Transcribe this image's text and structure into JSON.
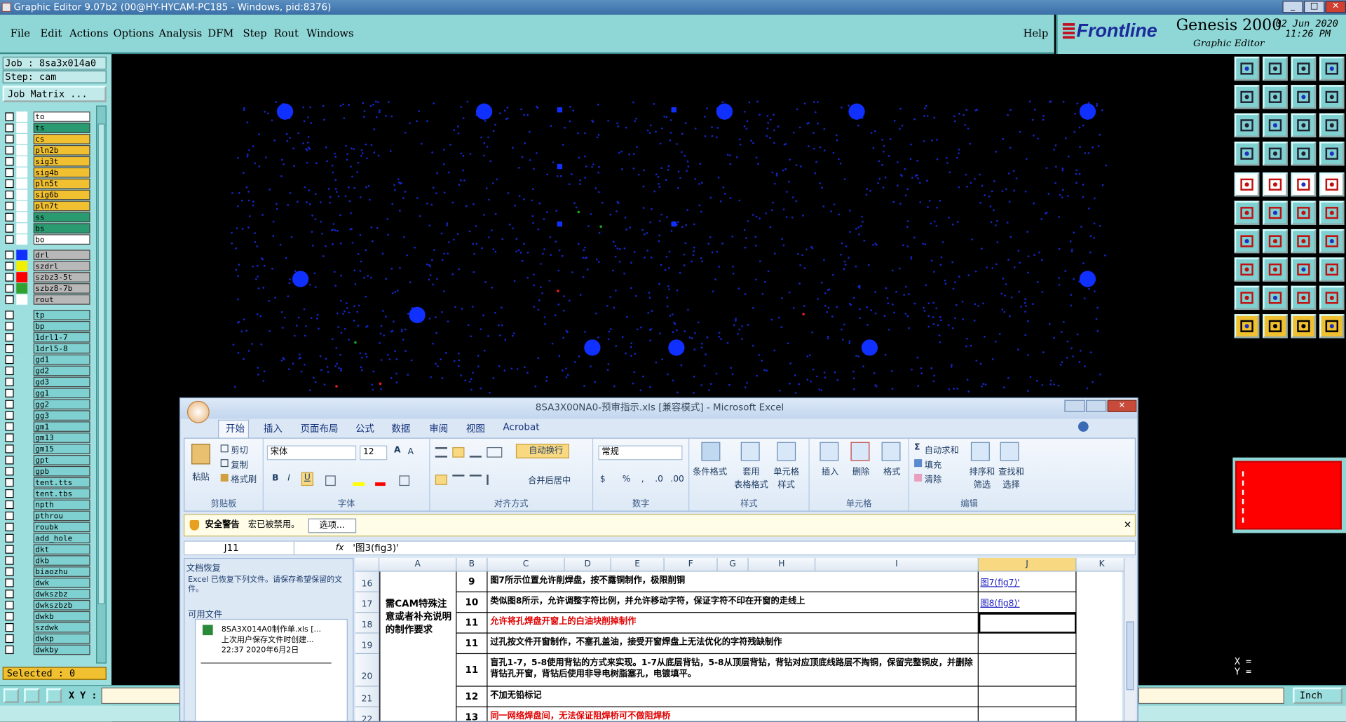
{
  "window": {
    "title": "Graphic Editor 9.07b2 (00@HY-HYCAM-PC185 - Windows, pid:8376)",
    "controls": [
      "_",
      "□",
      "✕"
    ]
  },
  "menu": {
    "items": [
      "File",
      "Edit",
      "Actions",
      "Options",
      "Analysis",
      "DFM",
      "Step",
      "Rout",
      "Windows"
    ],
    "help": "Help"
  },
  "brand": {
    "logo": "Frontline",
    "product": "Genesis 2000",
    "subtitle": "Graphic Editor",
    "date": "02 Jun 2020",
    "time": "11:26 PM"
  },
  "job": {
    "job_line": "Job : 8sa3x014a0",
    "step_line": "Step: cam",
    "matrix_button": "Job Matrix ..."
  },
  "layers": [
    {
      "name": "to",
      "color": "#ffffff",
      "swatch": "#ffffff",
      "fg": "#000"
    },
    {
      "name": "ts",
      "color": "#2a9a70",
      "swatch": "#ffffff",
      "fg": "#000"
    },
    {
      "name": "cs",
      "color": "#f0c030",
      "swatch": "#ffffff",
      "fg": "#000"
    },
    {
      "name": "pln2b",
      "color": "#f0c030",
      "swatch": "#ffffff",
      "fg": "#000"
    },
    {
      "name": "sig3t",
      "color": "#f0c030",
      "swatch": "#ffffff",
      "fg": "#000"
    },
    {
      "name": "sig4b",
      "color": "#f0c030",
      "swatch": "#ffffff",
      "fg": "#000"
    },
    {
      "name": "pln5t",
      "color": "#f0c030",
      "swatch": "#ffffff",
      "fg": "#000"
    },
    {
      "name": "sig6b",
      "color": "#f0c030",
      "swatch": "#ffffff",
      "fg": "#000"
    },
    {
      "name": "pln7t",
      "color": "#f0c030",
      "swatch": "#ffffff",
      "fg": "#000"
    },
    {
      "name": "ss",
      "color": "#2a9a70",
      "swatch": "#ffffff",
      "fg": "#000"
    },
    {
      "name": "bs",
      "color": "#2a9a70",
      "swatch": "#ffffff",
      "fg": "#000"
    },
    {
      "name": "bo",
      "color": "#ffffff",
      "swatch": "#ffffff",
      "fg": "#000"
    },
    {
      "name": "drl",
      "color": "#b8b8b8",
      "swatch": "#1030ff",
      "fg": "#000"
    },
    {
      "name": "szdrl",
      "color": "#b8b8b8",
      "swatch": "#f0f000",
      "fg": "#000"
    },
    {
      "name": "szbz3-5t",
      "color": "#b8b8b8",
      "swatch": "#ff0000",
      "fg": "#000"
    },
    {
      "name": "szbz8-7b",
      "color": "#b8b8b8",
      "swatch": "#30a030",
      "fg": "#000"
    },
    {
      "name": "rout",
      "color": "#b8b8b8",
      "swatch": "#ffffff",
      "fg": "#000"
    },
    {
      "name": "tp",
      "color": "#7fd0d0",
      "swatch": "#9ddede",
      "fg": "#000"
    },
    {
      "name": "bp",
      "color": "#7fd0d0",
      "swatch": "#9ddede",
      "fg": "#000"
    },
    {
      "name": "1drl1-7",
      "color": "#7fd0d0",
      "swatch": "#9ddede",
      "fg": "#000"
    },
    {
      "name": "1drl5-8",
      "color": "#7fd0d0",
      "swatch": "#9ddede",
      "fg": "#000"
    },
    {
      "name": "gd1",
      "color": "#7fd0d0",
      "swatch": "#9ddede",
      "fg": "#000"
    },
    {
      "name": "gd2",
      "color": "#7fd0d0",
      "swatch": "#9ddede",
      "fg": "#000"
    },
    {
      "name": "gd3",
      "color": "#7fd0d0",
      "swatch": "#9ddede",
      "fg": "#000"
    },
    {
      "name": "gg1",
      "color": "#7fd0d0",
      "swatch": "#9ddede",
      "fg": "#000"
    },
    {
      "name": "gg2",
      "color": "#7fd0d0",
      "swatch": "#9ddede",
      "fg": "#000"
    },
    {
      "name": "gg3",
      "color": "#7fd0d0",
      "swatch": "#9ddede",
      "fg": "#000"
    },
    {
      "name": "gm1",
      "color": "#7fd0d0",
      "swatch": "#9ddede",
      "fg": "#000"
    },
    {
      "name": "gm13",
      "color": "#7fd0d0",
      "swatch": "#9ddede",
      "fg": "#000"
    },
    {
      "name": "gm15",
      "color": "#7fd0d0",
      "swatch": "#9ddede",
      "fg": "#000"
    },
    {
      "name": "gpt",
      "color": "#7fd0d0",
      "swatch": "#9ddede",
      "fg": "#000"
    },
    {
      "name": "gpb",
      "color": "#7fd0d0",
      "swatch": "#9ddede",
      "fg": "#000"
    },
    {
      "name": "tent.tts",
      "color": "#7fd0d0",
      "swatch": "#9ddede",
      "fg": "#000"
    },
    {
      "name": "tent.tbs",
      "color": "#7fd0d0",
      "swatch": "#9ddede",
      "fg": "#000"
    },
    {
      "name": "npth",
      "color": "#7fd0d0",
      "swatch": "#9ddede",
      "fg": "#000"
    },
    {
      "name": "pthrou",
      "color": "#7fd0d0",
      "swatch": "#9ddede",
      "fg": "#000"
    },
    {
      "name": "roubk",
      "color": "#7fd0d0",
      "swatch": "#9ddede",
      "fg": "#000"
    },
    {
      "name": "add_hole",
      "color": "#7fd0d0",
      "swatch": "#9ddede",
      "fg": "#000"
    },
    {
      "name": "dkt",
      "color": "#7fd0d0",
      "swatch": "#9ddede",
      "fg": "#000"
    },
    {
      "name": "dkb",
      "color": "#7fd0d0",
      "swatch": "#9ddede",
      "fg": "#000"
    },
    {
      "name": "biaozhu",
      "color": "#7fd0d0",
      "swatch": "#9ddede",
      "fg": "#000"
    },
    {
      "name": "dwk",
      "color": "#7fd0d0",
      "swatch": "#9ddede",
      "fg": "#000"
    },
    {
      "name": "dwkszbz",
      "color": "#7fd0d0",
      "swatch": "#9ddede",
      "fg": "#000"
    },
    {
      "name": "dwkszbzb",
      "color": "#7fd0d0",
      "swatch": "#9ddede",
      "fg": "#000"
    },
    {
      "name": "dwkb",
      "color": "#7fd0d0",
      "swatch": "#9ddede",
      "fg": "#000"
    },
    {
      "name": "szdwk",
      "color": "#7fd0d0",
      "swatch": "#9ddede",
      "fg": "#000"
    },
    {
      "name": "dwkp",
      "color": "#7fd0d0",
      "swatch": "#9ddede",
      "fg": "#000"
    },
    {
      "name": "dwkby",
      "color": "#7fd0d0",
      "swatch": "#9ddede",
      "fg": "#000"
    }
  ],
  "status": {
    "selected": "Selected : 0",
    "xy_label": "X Y :",
    "units": "Inch",
    "coord_x": "X =",
    "coord_y": "Y ="
  },
  "excel": {
    "title": "8SA3X00NA0-预审指示.xls  [兼容模式]  -  Microsoft Excel",
    "tabs": [
      "开始",
      "插入",
      "页面布局",
      "公式",
      "数据",
      "审阅",
      "视图",
      "Acrobat"
    ],
    "ribbon": {
      "clipboard": {
        "paste": "粘贴",
        "cut": "剪切",
        "copy": "复制",
        "format_painter": "格式刷",
        "label": "剪贴板"
      },
      "font": {
        "name": "宋体",
        "size": "12",
        "label": "字体"
      },
      "alignment": {
        "wrap": "自动换行",
        "merge": "合并后居中",
        "label": "对齐方式"
      },
      "number": {
        "format": "常规",
        "label": "数字"
      },
      "styles": {
        "conditional": "条件格式",
        "table": "套用\n表格格式",
        "cell": "单元格\n样式",
        "label": "样式"
      },
      "cells": {
        "insert": "插入",
        "delete": "删除",
        "format": "格式",
        "label": "单元格"
      },
      "editing": {
        "autosum": "自动求和",
        "fill": "填充",
        "clear": "清除",
        "sort": "排序和\n筛选",
        "find": "查找和\n选择",
        "label": "编辑"
      }
    },
    "security": {
      "label": "安全警告",
      "message": "宏已被禁用。",
      "options": "选项..."
    },
    "namebox": "J11",
    "formula": "'图3(fig3)'",
    "recovery": {
      "title": "文档恢复",
      "desc": "Excel 已恢复下列文件。请保存希望保留的文件。",
      "available": "可用文件",
      "file_name": "8SA3X014A0制作单.xls  [...",
      "file_desc": "上次用户保存文件时创建...",
      "file_time": "22:37 2020年6月2日"
    },
    "columns": [
      "A",
      "B",
      "C",
      "D",
      "E",
      "F",
      "G",
      "H",
      "I",
      "J",
      "K"
    ],
    "row_numbers": [
      "16",
      "17",
      "18",
      "19",
      "20",
      "21",
      "22"
    ],
    "merged_a": "需CAM特殊注意或者补充说明的制作要求",
    "rows": [
      {
        "num": "9",
        "text": "图7所示位置允许削焊盘，按不露铜制作，极限削铜",
        "link": "图7(fig7)'",
        "red": false
      },
      {
        "num": "10",
        "text": "类似图8所示，允许调整字符比例，并允许移动字符，保证字符不印在开窗的走线上",
        "link": "图8(fig8)'",
        "red": false
      },
      {
        "num": "11",
        "text": "允许将孔焊盘开窗上的白油块削掉制作",
        "link": "",
        "red": true
      },
      {
        "num": "11",
        "text": "过孔按文件开窗制作，不塞孔盖油，接受开窗焊盘上无法优化的字符残缺制作",
        "link": "",
        "red": false
      },
      {
        "num": "11",
        "text": "盲孔1-7，5-8使用背钻的方式来实现。1-7从底层背钻，5-8从顶层背钻，背钻对应顶底线路层不掏铜，保留完整铜皮，并删除背钻孔开窗，背钻后使用非导电树脂塞孔，电镀填平。",
        "link": "",
        "red": false
      },
      {
        "num": "12",
        "text": "不加无铅标记",
        "link": "",
        "red": false
      },
      {
        "num": "13",
        "text": "同一网络焊盘间，无法保证阻焊桥可不做阻焊桥",
        "link": "",
        "red": true
      }
    ]
  }
}
